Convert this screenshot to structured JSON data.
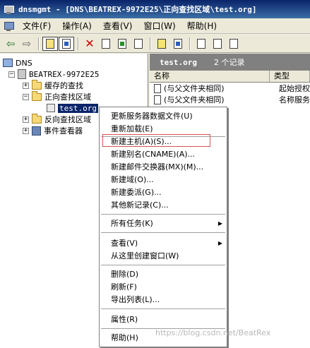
{
  "window": {
    "title": "dnsmgmt - [DNS\\BEATREX-9972E25\\正向查找区域\\test.org]"
  },
  "menu": [
    "文件(F)",
    "操作(A)",
    "查看(V)",
    "窗口(W)",
    "帮助(H)"
  ],
  "tree": {
    "root": "DNS",
    "server": "BEATREX-9972E25",
    "cache": "缓存的查找",
    "forward": "正向查找区域",
    "zone": "test.org",
    "reverse": "反向查找区域",
    "events": "事件查看器"
  },
  "right": {
    "zone": "test.org",
    "count": "2 个记录",
    "col_name": "名称",
    "col_type": "类型",
    "rows": [
      {
        "name": "(与父文件夹相同)",
        "type": "起始授权"
      },
      {
        "name": "(与父文件夹相同)",
        "type": "名称服务"
      }
    ]
  },
  "context_menu": {
    "update": "更新服务器数据文件(U)",
    "reload": "重新加载(E)",
    "new_host": "新建主机(A)(S)...",
    "new_alias": "新建别名(CNAME)(A)...",
    "new_mx": "新建邮件交换器(MX)(M)...",
    "new_domain": "新建域(O)...",
    "new_delegation": "新建委派(G)...",
    "other": "其他新记录(C)...",
    "all_tasks": "所有任务(K)",
    "view": "查看(V)",
    "new_window": "从这里创建窗口(W)",
    "delete": "删除(D)",
    "refresh": "刷新(F)",
    "export": "导出列表(L)...",
    "properties": "属性(R)",
    "help": "帮助(H)"
  },
  "watermark": "https://blog.csdn.net/BeatRex"
}
